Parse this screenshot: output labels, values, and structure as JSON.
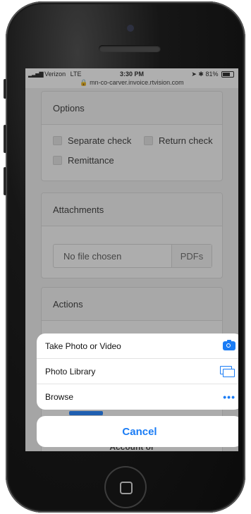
{
  "status_bar": {
    "carrier": "Verizon",
    "network": "LTE",
    "time": "3:30 PM",
    "battery": "81%",
    "battery_level": 0.81,
    "url": "mn-co-carver.invoice.rtvision.com"
  },
  "options": {
    "title": "Options",
    "checkboxes": [
      "Separate check",
      "Return check",
      "Remittance"
    ]
  },
  "attachments": {
    "title": "Attachments",
    "file_status": "No file chosen",
    "file_button": "PDFs"
  },
  "actions": {
    "title": "Actions"
  },
  "action_sheet": {
    "items": [
      {
        "label": "Take Photo or Video",
        "icon": "camera-icon"
      },
      {
        "label": "Photo Library",
        "icon": "photo-library-icon"
      },
      {
        "label": "Browse",
        "icon": "more-icon"
      }
    ],
    "cancel": "Cancel"
  },
  "underlying_text": "Account or",
  "colors": {
    "accent": "#1a7cf5",
    "green_button": "#2e8b3d",
    "red_button": "#c0333c"
  }
}
